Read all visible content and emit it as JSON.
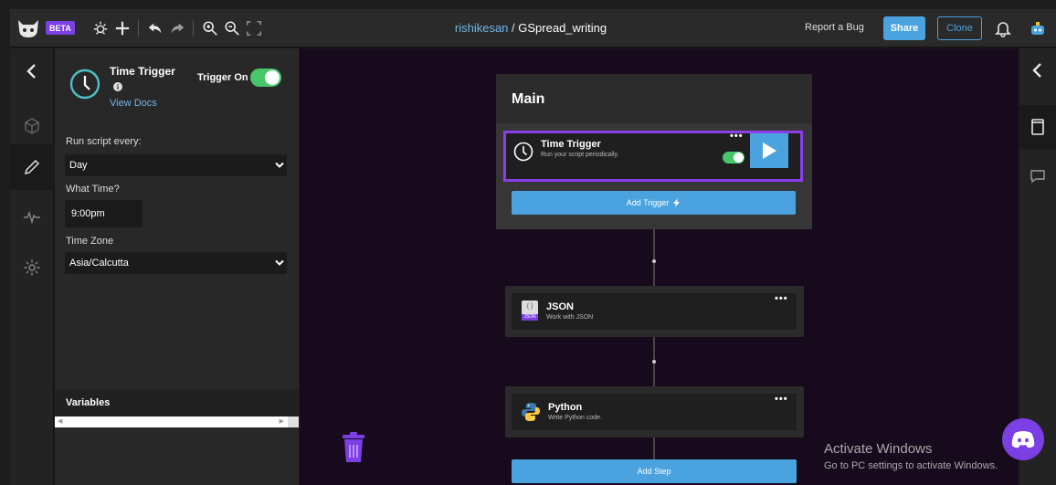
{
  "header": {
    "beta_label": "BETA",
    "user": "rishikesan",
    "separator": " / ",
    "project": "GSpread_writing",
    "report_bug": "Report a Bug",
    "share": "Share",
    "clone": "Clone"
  },
  "panel": {
    "title": "Time Trigger",
    "info": "i",
    "view_docs": "View Docs",
    "trigger_on_label": "Trigger On",
    "trigger_on": true,
    "run_every_label": "Run script every:",
    "run_every_value": "Day",
    "what_time_label": "What Time?",
    "time_value": "9:00pm",
    "timezone_label": "Time Zone",
    "timezone_value": "Asia/Calcutta",
    "variables_label": "Variables"
  },
  "canvas": {
    "main_title": "Main",
    "trigger_node": {
      "title": "Time Trigger",
      "subtitle": "Run your script periodically.",
      "menu": "•••"
    },
    "add_trigger": "Add Trigger",
    "add_trigger_icon": "bolt-icon",
    "steps": [
      {
        "title": "JSON",
        "subtitle": "Work with JSON",
        "menu": "•••",
        "icon_tag": "JSON",
        "icon_glyph": "{ }"
      },
      {
        "title": "Python",
        "subtitle": "Write Python code.",
        "menu": "•••"
      }
    ],
    "add_step": "Add Step"
  },
  "watermark": {
    "line1": "Activate Windows",
    "line2": "Go to PC settings to activate Windows."
  },
  "colors": {
    "accent_blue": "#4aa3df",
    "accent_purple": "#8b3fe8",
    "toggle_green": "#48c76a",
    "canvas_bg": "#170a1c"
  }
}
